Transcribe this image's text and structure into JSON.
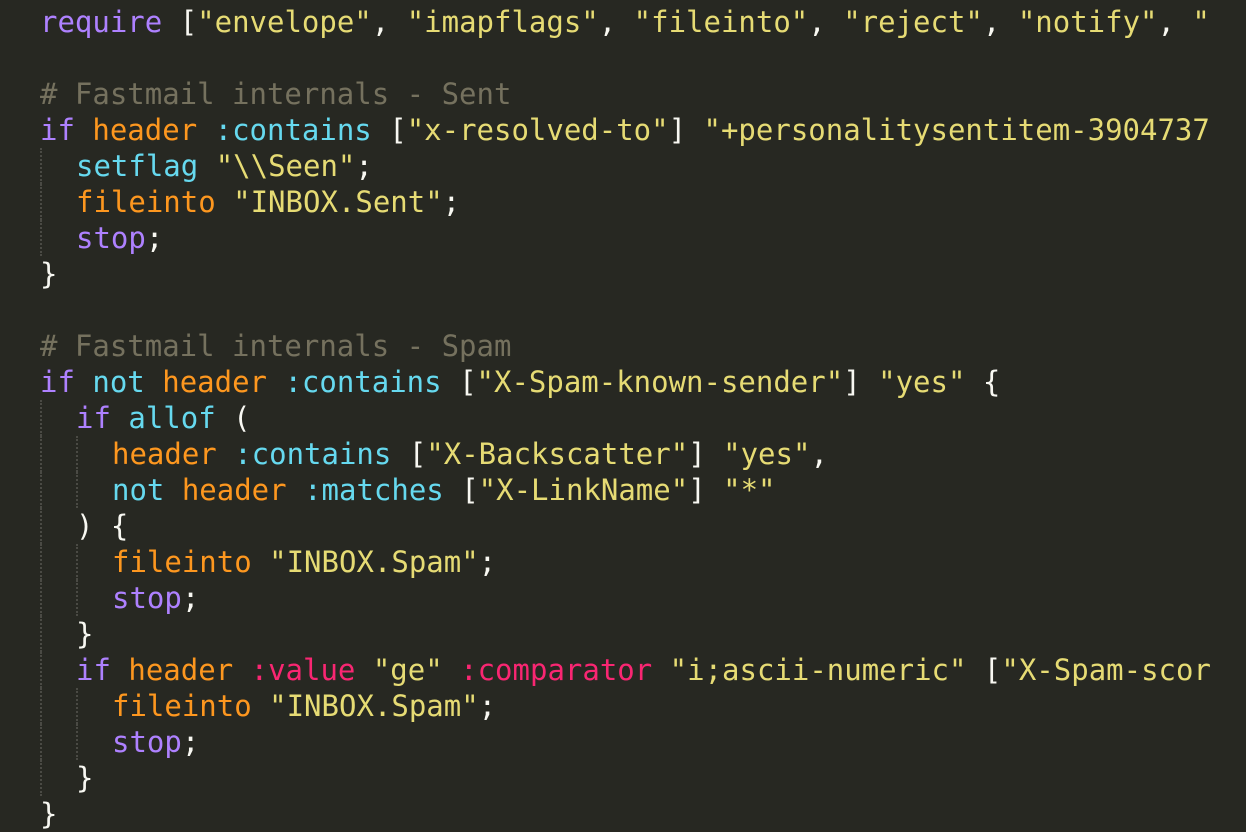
{
  "editor": {
    "lines": [
      {
        "indent": 0,
        "tokens": [
          {
            "t": "require ",
            "c": "#ae81ff"
          },
          {
            "t": "[",
            "c": "#f8f8f2"
          },
          {
            "t": "\"envelope\"",
            "c": "#e6db74"
          },
          {
            "t": ", ",
            "c": "#f8f8f2"
          },
          {
            "t": "\"imapflags\"",
            "c": "#e6db74"
          },
          {
            "t": ", ",
            "c": "#f8f8f2"
          },
          {
            "t": "\"fileinto\"",
            "c": "#e6db74"
          },
          {
            "t": ", ",
            "c": "#f8f8f2"
          },
          {
            "t": "\"reject\"",
            "c": "#e6db74"
          },
          {
            "t": ", ",
            "c": "#f8f8f2"
          },
          {
            "t": "\"notify\"",
            "c": "#e6db74"
          },
          {
            "t": ", ",
            "c": "#f8f8f2"
          },
          {
            "t": "\"",
            "c": "#e6db74"
          }
        ]
      },
      {
        "indent": 0,
        "tokens": []
      },
      {
        "indent": 0,
        "tokens": [
          {
            "t": "# Fastmail internals - Sent",
            "c": "#75715e"
          }
        ]
      },
      {
        "indent": 0,
        "tokens": [
          {
            "t": "if ",
            "c": "#ae81ff"
          },
          {
            "t": "header ",
            "c": "#fd971f"
          },
          {
            "t": ":contains ",
            "c": "#66d9ef"
          },
          {
            "t": "[",
            "c": "#f8f8f2"
          },
          {
            "t": "\"x-resolved-to\"",
            "c": "#e6db74"
          },
          {
            "t": "] ",
            "c": "#f8f8f2"
          },
          {
            "t": "\"+personalitysentitem-3904737",
            "c": "#e6db74"
          }
        ]
      },
      {
        "indent": 1,
        "tokens": [
          {
            "t": "setflag ",
            "c": "#66d9ef"
          },
          {
            "t": "\"\\\\Seen\"",
            "c": "#e6db74"
          },
          {
            "t": ";",
            "c": "#f8f8f2"
          }
        ]
      },
      {
        "indent": 1,
        "tokens": [
          {
            "t": "fileinto ",
            "c": "#fd971f"
          },
          {
            "t": "\"INBOX.Sent\"",
            "c": "#e6db74"
          },
          {
            "t": ";",
            "c": "#f8f8f2"
          }
        ]
      },
      {
        "indent": 1,
        "tokens": [
          {
            "t": "stop",
            "c": "#ae81ff"
          },
          {
            "t": ";",
            "c": "#f8f8f2"
          }
        ]
      },
      {
        "indent": 0,
        "tokens": [
          {
            "t": "}",
            "c": "#f8f8f2"
          }
        ]
      },
      {
        "indent": 0,
        "tokens": []
      },
      {
        "indent": 0,
        "tokens": [
          {
            "t": "# Fastmail internals - Spam",
            "c": "#75715e"
          }
        ]
      },
      {
        "indent": 0,
        "tokens": [
          {
            "t": "if ",
            "c": "#ae81ff"
          },
          {
            "t": "not ",
            "c": "#66d9ef"
          },
          {
            "t": "header ",
            "c": "#fd971f"
          },
          {
            "t": ":contains ",
            "c": "#66d9ef"
          },
          {
            "t": "[",
            "c": "#f8f8f2"
          },
          {
            "t": "\"X-Spam-known-sender\"",
            "c": "#e6db74"
          },
          {
            "t": "] ",
            "c": "#f8f8f2"
          },
          {
            "t": "\"yes\"",
            "c": "#e6db74"
          },
          {
            "t": " {",
            "c": "#f8f8f2"
          }
        ]
      },
      {
        "indent": 1,
        "tokens": [
          {
            "t": "if ",
            "c": "#ae81ff"
          },
          {
            "t": "allof ",
            "c": "#66d9ef"
          },
          {
            "t": "(",
            "c": "#f8f8f2"
          }
        ]
      },
      {
        "indent": 2,
        "tokens": [
          {
            "t": "header ",
            "c": "#fd971f"
          },
          {
            "t": ":contains ",
            "c": "#66d9ef"
          },
          {
            "t": "[",
            "c": "#f8f8f2"
          },
          {
            "t": "\"X-Backscatter\"",
            "c": "#e6db74"
          },
          {
            "t": "] ",
            "c": "#f8f8f2"
          },
          {
            "t": "\"yes\"",
            "c": "#e6db74"
          },
          {
            "t": ",",
            "c": "#f8f8f2"
          }
        ]
      },
      {
        "indent": 2,
        "tokens": [
          {
            "t": "not ",
            "c": "#66d9ef"
          },
          {
            "t": "header ",
            "c": "#fd971f"
          },
          {
            "t": ":matches ",
            "c": "#66d9ef"
          },
          {
            "t": "[",
            "c": "#f8f8f2"
          },
          {
            "t": "\"X-LinkName\"",
            "c": "#e6db74"
          },
          {
            "t": "] ",
            "c": "#f8f8f2"
          },
          {
            "t": "\"*\"",
            "c": "#e6db74"
          }
        ]
      },
      {
        "indent": 1,
        "tokens": [
          {
            "t": ") {",
            "c": "#f8f8f2"
          }
        ]
      },
      {
        "indent": 2,
        "tokens": [
          {
            "t": "fileinto ",
            "c": "#fd971f"
          },
          {
            "t": "\"INBOX.Spam\"",
            "c": "#e6db74"
          },
          {
            "t": ";",
            "c": "#f8f8f2"
          }
        ]
      },
      {
        "indent": 2,
        "tokens": [
          {
            "t": "stop",
            "c": "#ae81ff"
          },
          {
            "t": ";",
            "c": "#f8f8f2"
          }
        ]
      },
      {
        "indent": 1,
        "tokens": [
          {
            "t": "}",
            "c": "#f8f8f2"
          }
        ]
      },
      {
        "indent": 1,
        "tokens": [
          {
            "t": "if ",
            "c": "#ae81ff"
          },
          {
            "t": "header ",
            "c": "#fd971f"
          },
          {
            "t": ":value ",
            "c": "#f92672"
          },
          {
            "t": "\"ge\" ",
            "c": "#e6db74"
          },
          {
            "t": ":comparator ",
            "c": "#f92672"
          },
          {
            "t": "\"i;ascii-numeric\"",
            "c": "#e6db74"
          },
          {
            "t": " [",
            "c": "#f8f8f2"
          },
          {
            "t": "\"X-Spam-scor",
            "c": "#e6db74"
          }
        ]
      },
      {
        "indent": 2,
        "tokens": [
          {
            "t": "fileinto ",
            "c": "#fd971f"
          },
          {
            "t": "\"INBOX.Spam\"",
            "c": "#e6db74"
          },
          {
            "t": ";",
            "c": "#f8f8f2"
          }
        ]
      },
      {
        "indent": 2,
        "tokens": [
          {
            "t": "stop",
            "c": "#ae81ff"
          },
          {
            "t": ";",
            "c": "#f8f8f2"
          }
        ]
      },
      {
        "indent": 1,
        "tokens": [
          {
            "t": "}",
            "c": "#f8f8f2"
          }
        ]
      },
      {
        "indent": 0,
        "tokens": [
          {
            "t": "}",
            "c": "#f8f8f2"
          }
        ]
      }
    ]
  },
  "colors": {
    "background": "#272822",
    "indent_guide": "#4a4a44",
    "comment": "#75715e",
    "keyword": "#ae81ff",
    "function": "#fd971f",
    "tag": "#66d9ef",
    "string": "#e6db74",
    "operator": "#f92672",
    "plain": "#f8f8f2"
  }
}
